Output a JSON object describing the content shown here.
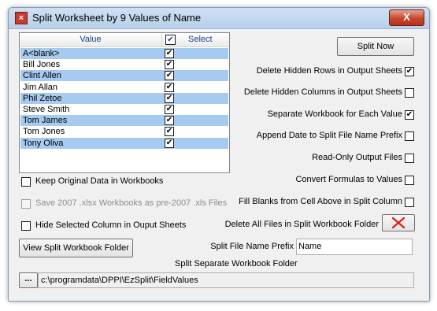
{
  "window": {
    "title": "Split Worksheet by 9 Values of Name",
    "close_label": "X",
    "app_icon": "x-icon"
  },
  "list": {
    "header_value": "Value",
    "header_select": "Select",
    "header_checked": true,
    "rows": [
      {
        "name": "A<blank>",
        "checked": true
      },
      {
        "name": "Bill Jones",
        "checked": true
      },
      {
        "name": "Clint Allen",
        "checked": true
      },
      {
        "name": "Jim Allan",
        "checked": true
      },
      {
        "name": "Phil Zetoe",
        "checked": true
      },
      {
        "name": "Steve Smith",
        "checked": true
      },
      {
        "name": "Tom James",
        "checked": true
      },
      {
        "name": "Tom Jones",
        "checked": true
      },
      {
        "name": "Tony Oliva",
        "checked": true
      }
    ]
  },
  "buttons": {
    "split_now": "Split Now",
    "view_folder": "View Split Workbook Folder",
    "browse": "...",
    "delete_files_icon": "red-x-icon"
  },
  "options_right": [
    {
      "label": "Delete Hidden Rows in Output Sheets",
      "checked": true
    },
    {
      "label": "Delete Hidden Columns in Output Sheets",
      "checked": false
    },
    {
      "label": "Separate Workbook for Each Value",
      "checked": true
    },
    {
      "label": "Append Date to Split File Name Prefix",
      "checked": false
    },
    {
      "label": "Read-Only Output Files",
      "checked": false
    },
    {
      "label": "Convert Formulas to Values",
      "checked": false
    },
    {
      "label": "Fill Blanks from Cell Above in Split Column",
      "checked": false
    }
  ],
  "options_left": {
    "keep_original": {
      "label": "Keep Original Data in Workbooks",
      "checked": false
    },
    "save_2007": {
      "label": "Save 2007 .xlsx Workbooks as pre-2007 .xls Files",
      "checked": false,
      "disabled": true
    },
    "hide_column": {
      "label": "Hide Selected Column in Ouput Sheets",
      "checked": false
    }
  },
  "delete_all_label": "Delete All Files in Split Workbook Folder",
  "prefix": {
    "label": "Split File Name Prefix",
    "value": "Name"
  },
  "folder": {
    "label": "Split Separate  Workbook Folder",
    "path": "c:\\programdata\\DPPI\\EzSplit\\FieldValues"
  },
  "colors": {
    "row_highlight": "#a6caf0",
    "title_bar": "#b8cfea",
    "close_red": "#c6462f"
  }
}
